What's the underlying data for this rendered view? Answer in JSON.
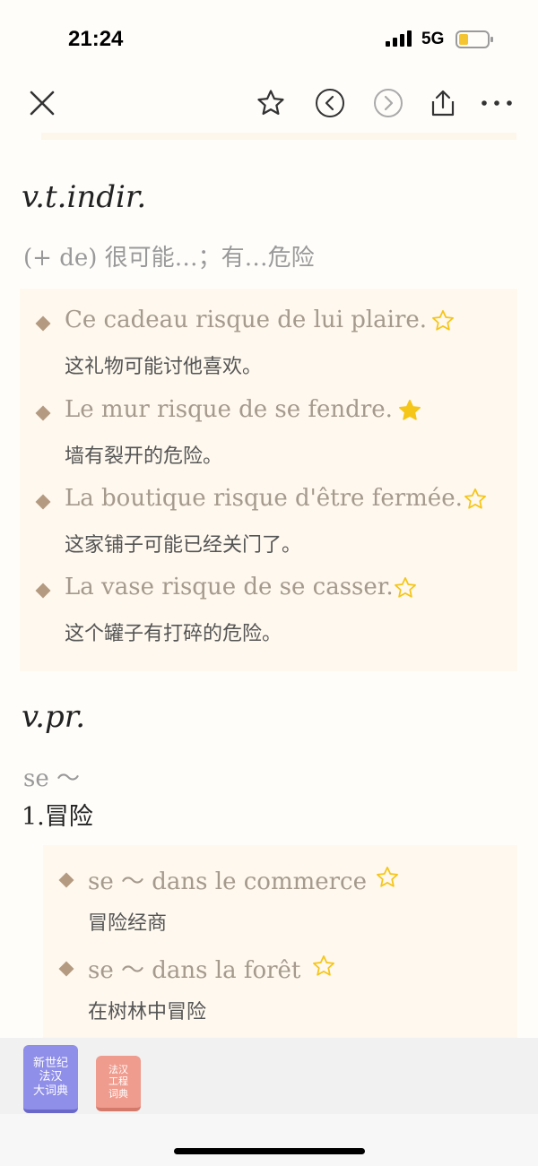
{
  "status_bar": {
    "time": "21:24",
    "network": "5G"
  },
  "colors": {
    "accent_star": "#f5c518",
    "example_bg": "#fef8ee",
    "diamond": "#b49a80"
  },
  "toolbar": {
    "close_icon": "close-icon",
    "star_icon": "star-outline-icon",
    "prev_icon": "chevron-left-circle-icon",
    "next_icon": "chevron-right-circle-icon",
    "share_icon": "share-icon",
    "more_icon": "more-icon"
  },
  "sections": [
    {
      "pos": "v.t.indir.",
      "sub": "(+ de) 很可能…；有…危险",
      "examples": [
        {
          "fr": "Ce cadeau risque de lui plaire.",
          "zh": "这礼物可能讨他喜欢。",
          "starred": false
        },
        {
          "fr": "Le mur risque de se fendre.",
          "zh": "墙有裂开的危险。",
          "starred": true
        },
        {
          "fr": "La boutique risque d'être fermée.",
          "zh": "这家铺子可能已经关门了。",
          "starred": false
        },
        {
          "fr": "La vase risque de se casser.",
          "zh": "这个罐子有打碎的危险。",
          "starred": false
        }
      ]
    },
    {
      "pos": "v.pr.",
      "sub": "se ～",
      "sense": "1.冒险",
      "examples": [
        {
          "fr": "se ～ dans le commerce",
          "zh": "冒险经商",
          "starred": false
        },
        {
          "fr": "se ～ dans la forêt",
          "zh": "在树林中冒险",
          "starred": false
        }
      ]
    }
  ],
  "dictionaries": [
    {
      "label_lines": [
        "新世纪",
        "法汉",
        "大词典"
      ],
      "color": "#8f8ee8"
    },
    {
      "label_lines": [
        "法汉",
        "工程",
        "词典"
      ],
      "color": "#ef9c8e"
    }
  ]
}
